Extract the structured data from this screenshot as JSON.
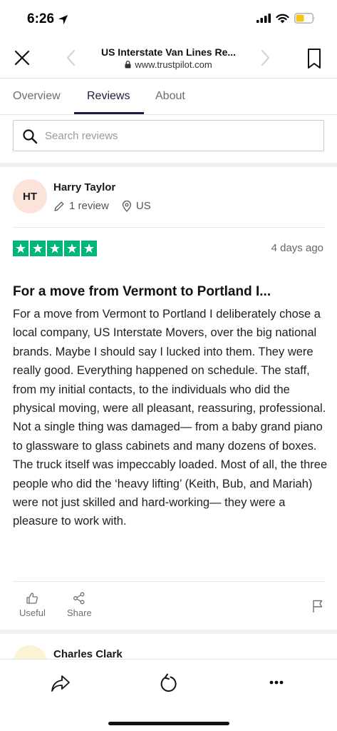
{
  "status_bar": {
    "time": "6:26",
    "icons": [
      "location-arrow-icon",
      "cellular-signal-icon",
      "wifi-icon",
      "battery-icon"
    ],
    "battery_color": "#f5c518"
  },
  "browser": {
    "title": "US Interstate Van Lines Re...",
    "url": "www.trustpilot.com",
    "icons": [
      "close-icon",
      "back-chevron-icon",
      "forward-chevron-icon",
      "lock-icon",
      "bookmark-icon"
    ]
  },
  "tabs": [
    {
      "label": "Overview",
      "active": false
    },
    {
      "label": "Reviews",
      "active": true
    },
    {
      "label": "About",
      "active": false
    }
  ],
  "search": {
    "placeholder": "Search reviews",
    "value": ""
  },
  "review": {
    "avatar_initials": "HT",
    "reviewer_name": "Harry Taylor",
    "review_count": "1 review",
    "country": "US",
    "rating": 5,
    "rating_max": 5,
    "star_color": "#00b67a",
    "date": "4 days ago",
    "title": "For a move from Vermont to Portland I...",
    "body": "For a move from Vermont to Portland I deliberately chose a local company, US Interstate Movers, over the big national brands. Maybe I should say I lucked into them. They were really good. Everything happened on schedule. The staff, from my initial contacts, to the individuals who did the physical moving, were all pleasant, reassuring, professional. Not a single thing was damaged— from a baby grand piano to glassware to glass cabinets and many dozens of boxes. The truck itself was impeccably loaded. Most of all, the three people who did the ‘heavy lifting’ (Keith, Bub, and Mariah) were not just skilled and hard-working— they were a pleasure to work with.",
    "actions": {
      "useful_label": "Useful",
      "share_label": "Share"
    }
  },
  "next_review": {
    "reviewer_name": "Charles Clark"
  },
  "toolbar": {
    "icons": [
      "share-icon",
      "reload-icon",
      "more-icon"
    ]
  }
}
